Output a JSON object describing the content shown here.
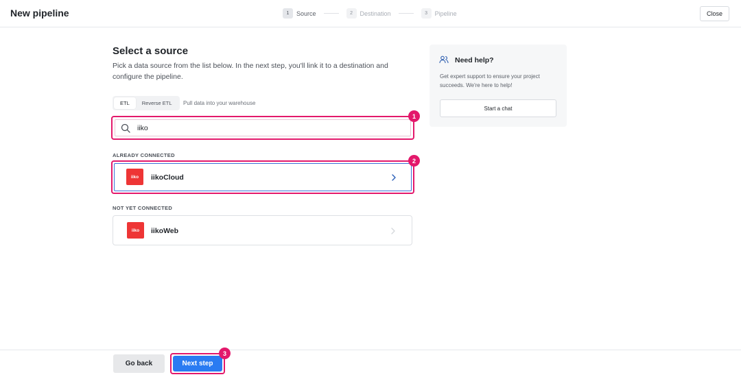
{
  "header": {
    "title": "New pipeline",
    "steps": [
      {
        "num": "1",
        "label": "Source"
      },
      {
        "num": "2",
        "label": "Destination"
      },
      {
        "num": "3",
        "label": "Pipeline"
      }
    ],
    "close_label": "Close"
  },
  "main": {
    "heading": "Select a source",
    "description": "Pick a data source from the list below. In the next step, you'll link it to a destination and configure the pipeline.",
    "mode_options": [
      "ETL",
      "Reverse ETL"
    ],
    "selected_mode": "ETL",
    "mode_caption": "Pull data into your warehouse",
    "search": {
      "value": "iiko",
      "icon": "search-icon"
    },
    "connected_section": {
      "label": "ALREADY CONNECTED",
      "items": [
        {
          "logo_text": "iiko",
          "name": "iikoCloud"
        }
      ]
    },
    "not_connected_section": {
      "label": "NOT YET CONNECTED",
      "items": [
        {
          "logo_text": "iiko",
          "name": "iikoWeb"
        }
      ]
    }
  },
  "help": {
    "icon": "people-icon",
    "title": "Need help?",
    "description": "Get expert support to ensure your project succeeds. We're here to help!",
    "button_label": "Start a chat"
  },
  "footer": {
    "back_label": "Go back",
    "next_label": "Next step"
  },
  "annotations": [
    "1",
    "2",
    "3"
  ],
  "colors": {
    "accent_blue": "#2a7bf2",
    "highlight_pink": "#e3186b",
    "brand_red": "#ee3535"
  }
}
